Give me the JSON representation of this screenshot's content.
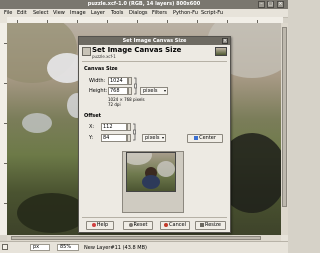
{
  "window": {
    "title": "puzzle.xcf-1.0 (RGB, 14 layers) 800x600"
  },
  "menubar": [
    "File",
    "Edit",
    "Select",
    "View",
    "Image",
    "Layer",
    "Tools",
    "Dialogs",
    "Filters",
    "Python-Fu",
    "Script-Fu"
  ],
  "dialog": {
    "window_title": "Set Image Canvas Size",
    "heading": "Set Image Canvas Size",
    "subtitle": "puzzle.xcf-1",
    "canvas_size": {
      "section": "Canvas Size",
      "width_label": "Width:",
      "width_value": "1024",
      "height_label": "Height:",
      "height_value": "768",
      "unit": "pixels",
      "size_info": "1024 × 768 pixels",
      "resolution": "72 dpi"
    },
    "offset": {
      "section": "Offset",
      "x_label": "X:",
      "x_value": "112",
      "y_label": "Y:",
      "y_value": "84",
      "unit": "pixels",
      "center_label": "Center"
    },
    "buttons": {
      "help": "Help",
      "reset": "Reset",
      "cancel": "Cancel",
      "resize": "Resize"
    }
  },
  "statusbar": {
    "unit": "px",
    "zoom": "85%",
    "message": "New Layer#11 (43.8 MB)"
  },
  "colors": {
    "dialog_title_bg": "#6e6b63",
    "main_title_bg": "#7a776f",
    "center_icon": "#3a6fd1"
  }
}
